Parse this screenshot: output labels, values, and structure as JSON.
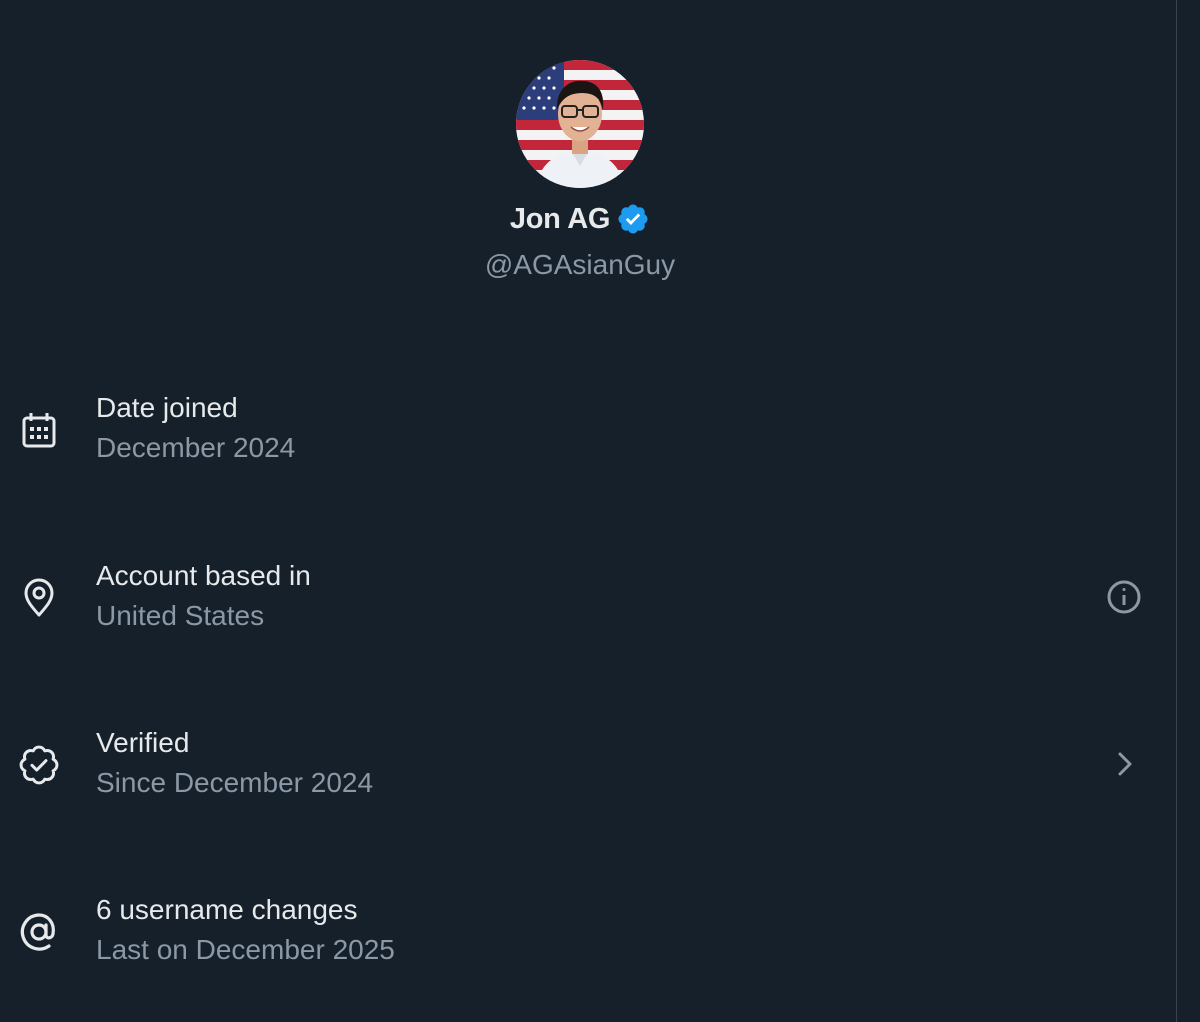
{
  "profile": {
    "display_name": "Jon AG",
    "handle": "@AGAsianGuy",
    "verified": true
  },
  "about": {
    "rows": [
      {
        "icon": "calendar-icon",
        "title": "Date joined",
        "subtitle": "December 2024",
        "trailing": null
      },
      {
        "icon": "location-pin-icon",
        "title": "Account based in",
        "subtitle": "United States",
        "trailing": "info-icon"
      },
      {
        "icon": "verified-check-icon",
        "title": "Verified",
        "subtitle": "Since December 2024",
        "trailing": "chevron-right-icon"
      },
      {
        "icon": "at-sign-icon",
        "title": "6 username changes",
        "subtitle": "Last on December 2025",
        "trailing": null
      }
    ]
  },
  "colors": {
    "background": "#15202b",
    "primary_text": "#e7e9ea",
    "secondary_text": "#8b98a5",
    "verified_blue": "#1d9bf0"
  }
}
